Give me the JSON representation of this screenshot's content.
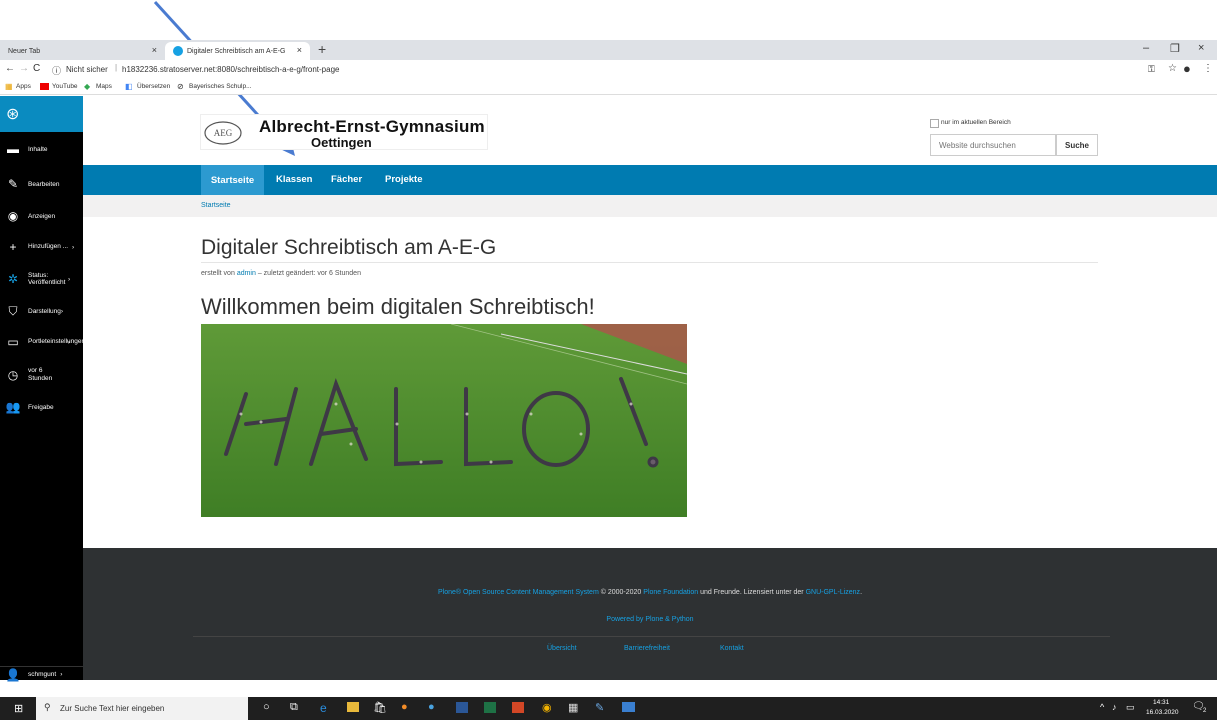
{
  "browser": {
    "tabs": [
      {
        "title": "Neuer Tab"
      },
      {
        "title": "Digitaler Schreibtisch am A-E-G"
      }
    ],
    "security_label": "Nicht sicher",
    "url": "h1832236.stratoserver.net:8080/schreibtisch-a-e-g/front-page",
    "bookmarks": [
      "Apps",
      "YouTube",
      "Maps",
      "Übersetzen",
      "Bayerisches Schulp..."
    ]
  },
  "toolbar": {
    "items": [
      {
        "label": "Inhalte",
        "icon": "folder-icon"
      },
      {
        "label": "Bearbeiten",
        "icon": "pencil-icon"
      },
      {
        "label": "Anzeigen",
        "icon": "eye-icon"
      },
      {
        "label": "Hinzufügen ...",
        "icon": "plus-icon"
      },
      {
        "label": "Status: Veröffentlicht",
        "icon": "status-icon"
      },
      {
        "label": "Darstellung",
        "icon": "display-icon"
      },
      {
        "label": "Portleteinstellungen",
        "icon": "portlet-icon"
      },
      {
        "label": "vor 6 Stunden",
        "icon": "clock-icon"
      },
      {
        "label": "Freigabe",
        "icon": "users-icon"
      }
    ],
    "user": "schmgunt"
  },
  "site": {
    "logo_text": "AEG",
    "name_line1": "Albrecht-Ernst-Gymnasium",
    "name_line2": "Oettingen",
    "search_checkbox_label": "nur im aktuellen Bereich",
    "search_placeholder": "Website durchsuchen",
    "search_button": "Suche"
  },
  "nav": [
    "Startseite",
    "Klassen",
    "Fächer",
    "Projekte"
  ],
  "breadcrumb": "Startseite",
  "content": {
    "title": "Digitaler Schreibtisch am A-E-G",
    "byline_prefix": "erstellt von",
    "byline_author": "admin",
    "byline_suffix": "– zuletzt geändert: vor 6 Stunden",
    "heading": "Willkommen beim digitalen Schreibtisch!"
  },
  "footer": {
    "line1_link1": "Plone® Open Source Content Management System",
    "line1_text1": "© 2000-2020",
    "line1_link2": "Plone Foundation",
    "line1_text2": "und Freunde. Lizensiert unter der",
    "line1_link3": "GNU-GPL-Lizenz",
    "line2": "Powered by Plone & Python",
    "links": [
      "Übersicht",
      "Barrierefreiheit",
      "Kontakt"
    ]
  },
  "taskbar": {
    "search_placeholder": "Zur Suche Text hier eingeben",
    "time": "14:31",
    "date": "16.03.2020",
    "notification_count": "2"
  },
  "colors": {
    "nav_blue": "#007bb1",
    "footer_bg": "#2e3133",
    "link_blue": "#16a1e3",
    "arrow": "#4472c4"
  }
}
